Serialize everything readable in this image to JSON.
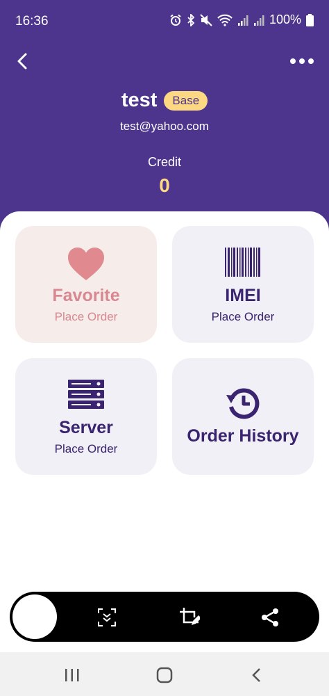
{
  "status_bar": {
    "time": "16:36",
    "battery": "100%",
    "icons": [
      "alarm-icon",
      "bluetooth-icon",
      "mute-icon",
      "wifi-icon",
      "signal-icon",
      "signal-icon",
      "battery-icon"
    ]
  },
  "header": {
    "back_icon": "chevron-left-icon",
    "more_icon": "more-horizontal-icon",
    "user_name": "test",
    "badge": "Base",
    "email": "test@yahoo.com",
    "credit_label": "Credit",
    "credit_value": "0"
  },
  "cards": {
    "favorite": {
      "title": "Favorite",
      "subtitle": "Place Order",
      "icon": "heart-icon"
    },
    "imei": {
      "title": "IMEI",
      "subtitle": "Place Order",
      "icon": "barcode-icon"
    },
    "server": {
      "title": "Server",
      "subtitle": "Place Order",
      "icon": "server-icon"
    },
    "order_history": {
      "title": "Order History",
      "icon": "history-icon"
    }
  },
  "screenshot_toolbar": {
    "icons": [
      "capture-button",
      "scroll-capture-icon",
      "crop-edit-icon",
      "share-icon"
    ]
  },
  "nav_bar": {
    "icons": [
      "recents-icon",
      "home-icon",
      "back-icon"
    ]
  },
  "colors": {
    "header_bg": "#4d358e",
    "badge_bg": "#fdd883",
    "credit_value": "#fdd883",
    "card_bg": "#f2f0f7",
    "favorite_card_bg": "#f6ecea",
    "favorite_accent": "#d98790",
    "card_text": "#3a236f"
  }
}
